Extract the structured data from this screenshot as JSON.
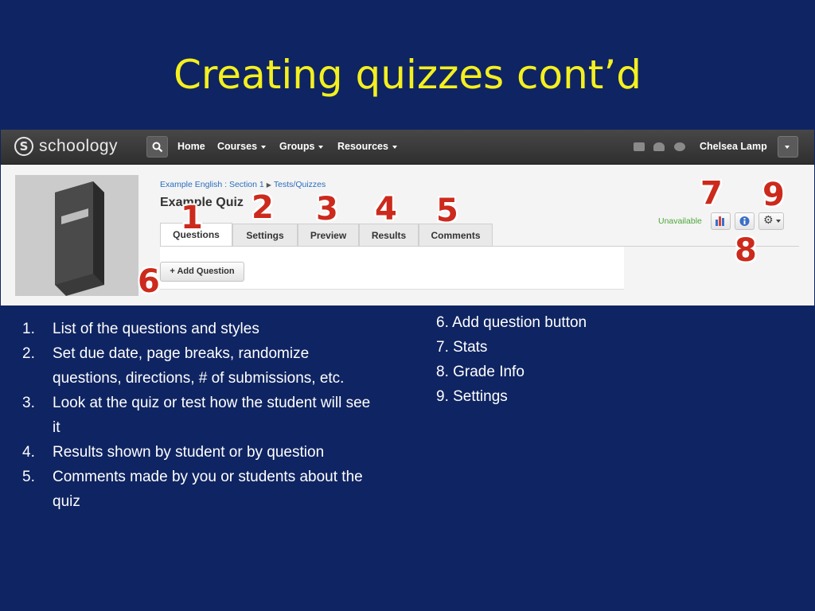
{
  "slide": {
    "title": "Creating quizzes cont’d"
  },
  "app": {
    "brand": "schoology",
    "nav": [
      {
        "label": "Home"
      },
      {
        "label": "Courses"
      },
      {
        "label": "Groups"
      },
      {
        "label": "Resources"
      }
    ],
    "user_name": "Chelsea Lamp",
    "icons": [
      "search-icon",
      "mail-icon",
      "people-icon",
      "notification-icon",
      "chevron-down-icon"
    ]
  },
  "page": {
    "breadcrumb": [
      "Example English : Section 1",
      "Tests/Quizzes"
    ],
    "title": "Example Quiz",
    "tabs": [
      {
        "label": "Questions",
        "active": true
      },
      {
        "label": "Settings"
      },
      {
        "label": "Preview"
      },
      {
        "label": "Results"
      },
      {
        "label": "Comments"
      }
    ],
    "add_question_label": "+ Add Question",
    "status": "Unavailable",
    "tool_icons": [
      "stats-icon",
      "info-icon",
      "gear-icon"
    ]
  },
  "markers": [
    "1",
    "2",
    "3",
    "4",
    "5",
    "6",
    "7",
    "8",
    "9"
  ],
  "notes_left": [
    {
      "num": "1.",
      "text": "List of the questions and styles"
    },
    {
      "num": "2.",
      "text": "Set due date, page breaks, randomize questions, directions, # of submissions, etc."
    },
    {
      "num": "3.",
      "text": "Look at the quiz or test how the student will see it"
    },
    {
      "num": "4.",
      "text": "Results shown by student or by question"
    },
    {
      "num": "5.",
      "text": "Comments made by you or students about the quiz"
    }
  ],
  "notes_right": [
    "6. Add question button",
    "7. Stats",
    "8. Grade Info",
    "9. Settings"
  ],
  "colors": {
    "background": "#0f2462",
    "title": "#f4f01e",
    "marker": "#cc2a1c",
    "status_green": "#4ea53b",
    "link_blue": "#2a6ebd"
  }
}
